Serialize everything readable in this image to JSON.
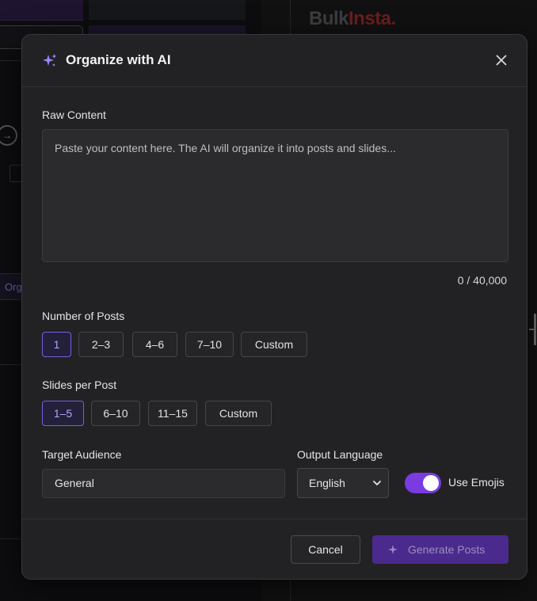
{
  "background": {
    "logo_bulk": "Bulk",
    "logo_insta": "Insta.",
    "sidebar_button_label": "Org"
  },
  "modal": {
    "title": "Organize with AI",
    "raw_content": {
      "label": "Raw Content",
      "placeholder": "Paste your content here. The AI will organize it into posts and slides...",
      "value": "",
      "counter": "0 / 40,000"
    },
    "number_of_posts": {
      "label": "Number of Posts",
      "options": [
        "1",
        "2–3",
        "4–6",
        "7–10",
        "Custom"
      ],
      "selected": "1"
    },
    "slides_per_post": {
      "label": "Slides per Post",
      "options": [
        "1–5",
        "6–10",
        "11–15",
        "Custom"
      ],
      "selected": "1–5"
    },
    "target_audience": {
      "label": "Target Audience",
      "value": "General"
    },
    "output_language": {
      "label": "Output Language",
      "selected": "English"
    },
    "use_emojis": {
      "label": "Use Emojis",
      "enabled": true
    },
    "actions": {
      "cancel_label": "Cancel",
      "generate_label": "Generate Posts"
    }
  },
  "colors": {
    "accent": "#7a3be0",
    "selected_border": "#7b5de0",
    "modal_bg": "#222224"
  },
  "icons": {
    "title_icon": "sparkle-icon",
    "close_icon": "close-icon",
    "generate_icon": "sparkle-icon",
    "select_icon": "chevron-down-icon"
  }
}
